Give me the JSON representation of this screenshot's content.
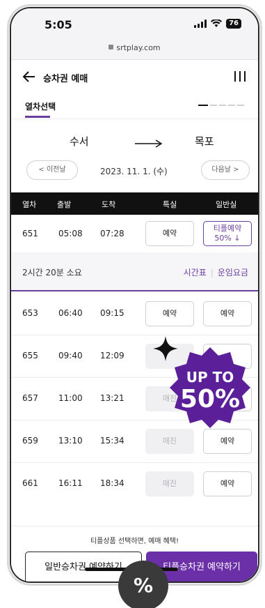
{
  "status_bar": {
    "time": "5:05",
    "battery": "76"
  },
  "browser": {
    "url": "srtplay.com"
  },
  "header": {
    "title": "승차권 예매"
  },
  "step": {
    "label": "열차선택"
  },
  "route": {
    "from": "수서",
    "to": "목포"
  },
  "date_nav": {
    "prev": "< 이전날",
    "date": "2023. 11. 1. (수)",
    "next": "다음날 >"
  },
  "table": {
    "headers": [
      "열차",
      "출발",
      "도착",
      "특실",
      "일반실"
    ],
    "rows": [
      {
        "train": "651",
        "dep": "05:08",
        "arr": "07:28",
        "special": "예약",
        "general": "티플예약",
        "general_sub": "50% ↓"
      },
      {
        "train": "653",
        "dep": "06:40",
        "arr": "09:15",
        "special": "예약",
        "general": "예약"
      },
      {
        "train": "655",
        "dep": "09:40",
        "arr": "12:09",
        "special": "",
        "general": ""
      },
      {
        "train": "657",
        "dep": "11:00",
        "arr": "13:21",
        "special": "매진",
        "general": "예약"
      },
      {
        "train": "659",
        "dep": "13:10",
        "arr": "15:34",
        "special": "매진",
        "general": "예약"
      },
      {
        "train": "661",
        "dep": "16:11",
        "arr": "18:34",
        "special": "매진",
        "general": "예약"
      }
    ]
  },
  "duration": {
    "text": "2시간 20분 소요",
    "timetable": "시간표",
    "fare": "운임요금"
  },
  "badge": {
    "line1": "UP TO",
    "line2": "50%"
  },
  "bottom": {
    "promo": "티플상품 선택하면, 예매 혜택!",
    "general_btn": "일반승차권 예약하기",
    "tpl_btn": "티플승차권 예약하기"
  },
  "overlay": {
    "percent": "%"
  },
  "colors": {
    "accent": "#6b3fa0",
    "badge": "#5b1f9a"
  }
}
